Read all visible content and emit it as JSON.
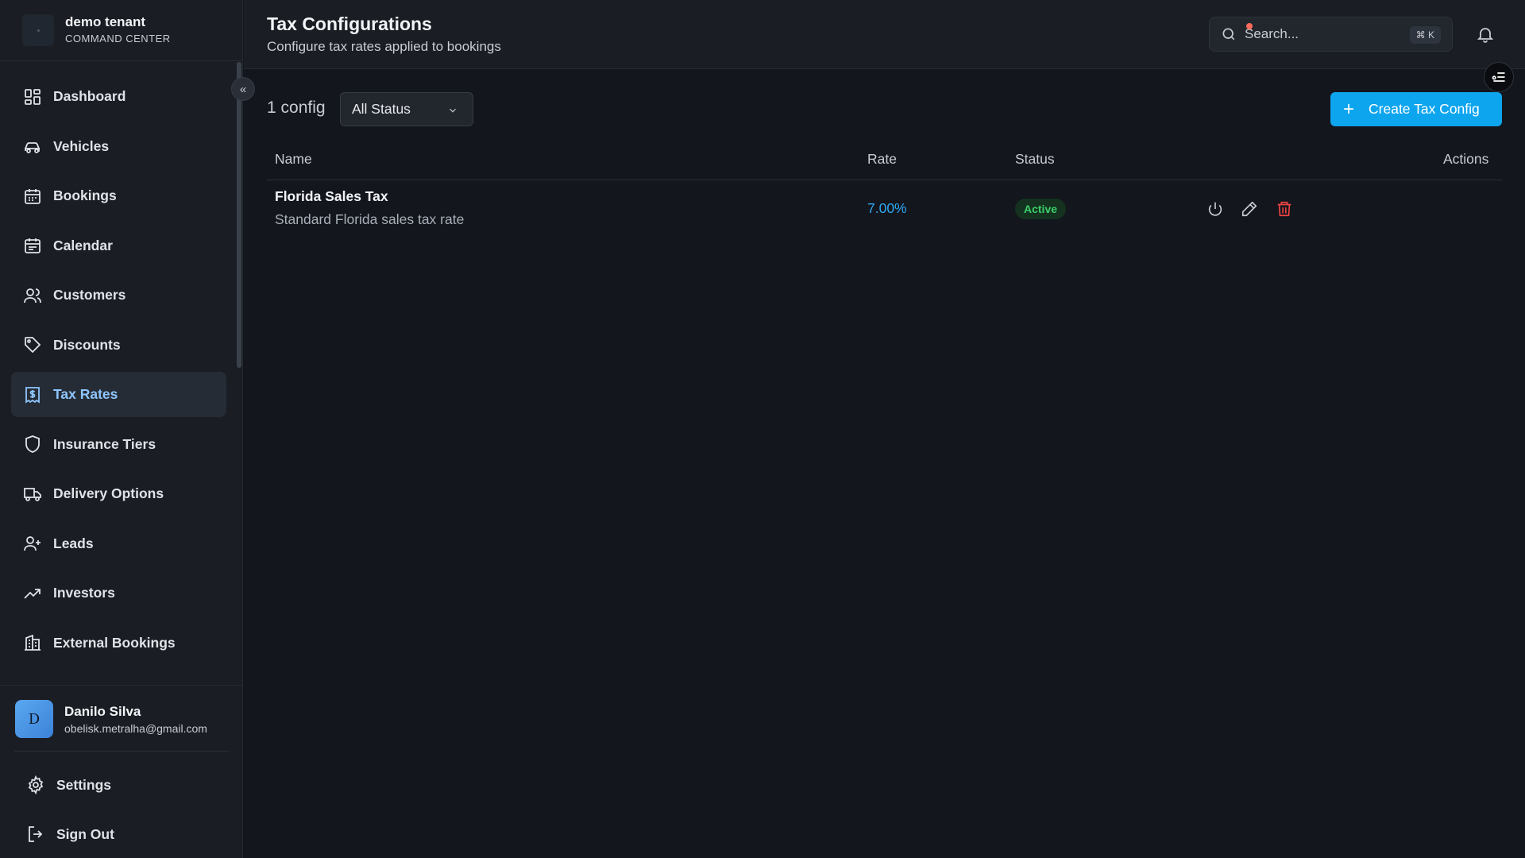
{
  "brand": {
    "name": "demo tenant",
    "subtitle": "COMMAND CENTER"
  },
  "sidebar": {
    "items": [
      {
        "label": "Dashboard",
        "icon": "dashboard-icon",
        "active": false
      },
      {
        "label": "Vehicles",
        "icon": "car-icon",
        "active": false
      },
      {
        "label": "Bookings",
        "icon": "calendar-grid-icon",
        "active": false
      },
      {
        "label": "Calendar",
        "icon": "calendar-icon",
        "active": false
      },
      {
        "label": "Customers",
        "icon": "users-icon",
        "active": false
      },
      {
        "label": "Discounts",
        "icon": "tag-icon",
        "active": false
      },
      {
        "label": "Tax Rates",
        "icon": "receipt-dollar-icon",
        "active": true
      },
      {
        "label": "Insurance Tiers",
        "icon": "shield-icon",
        "active": false
      },
      {
        "label": "Delivery Options",
        "icon": "truck-icon",
        "active": false
      },
      {
        "label": "Leads",
        "icon": "user-plus-icon",
        "active": false
      },
      {
        "label": "Investors",
        "icon": "trending-up-icon",
        "active": false
      },
      {
        "label": "External Bookings",
        "icon": "building-icon",
        "active": false
      }
    ]
  },
  "user": {
    "initial": "D",
    "name": "Danilo Silva",
    "email": "obelisk.metralha@gmail.com"
  },
  "bottom": {
    "settings_label": "Settings",
    "signout_label": "Sign Out"
  },
  "header": {
    "title": "Tax Configurations",
    "subtitle": "Configure tax rates applied to bookings",
    "search_placeholder": "Search...",
    "search_shortcut": "⌘ K"
  },
  "toolbar": {
    "count_label": "1 config",
    "status_filter": "All Status",
    "create_label": "Create Tax Config"
  },
  "table": {
    "columns": {
      "name": "Name",
      "rate": "Rate",
      "status": "Status",
      "actions": "Actions"
    },
    "rows": [
      {
        "name": "Florida Sales Tax",
        "description": "Standard Florida sales tax rate",
        "rate": "7.00%",
        "status": "Active"
      }
    ]
  },
  "colors": {
    "accent": "#0ea5ef",
    "active_nav": "#8fc6ff",
    "status_active": "#3ccf6b",
    "danger": "#ef4444"
  }
}
